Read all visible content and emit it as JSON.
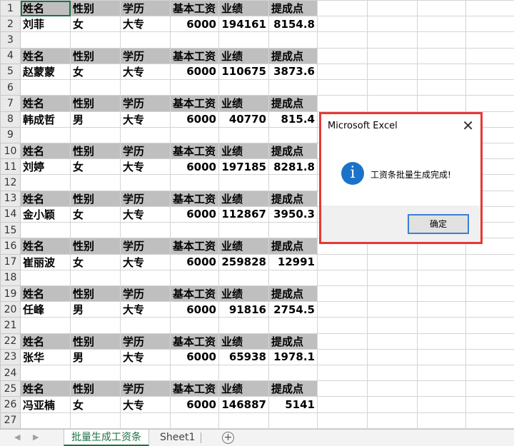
{
  "records": [
    {
      "row_header": "1",
      "data_row": "2",
      "name": "刘菲",
      "gender": "女",
      "education": "大专",
      "base_salary": "6000",
      "performance": "194161",
      "commission": "8154.8"
    },
    {
      "row_header": "4",
      "data_row": "5",
      "name": "赵蒙蒙",
      "gender": "女",
      "education": "大专",
      "base_salary": "6000",
      "performance": "110675",
      "commission": "3873.6"
    },
    {
      "row_header": "7",
      "data_row": "8",
      "name": "韩成哲",
      "gender": "男",
      "education": "大专",
      "base_salary": "6000",
      "performance": "40770",
      "commission": "815.4"
    },
    {
      "row_header": "10",
      "data_row": "11",
      "name": "刘婷",
      "gender": "女",
      "education": "大专",
      "base_salary": "6000",
      "performance": "197185",
      "commission": "8281.8"
    },
    {
      "row_header": "13",
      "data_row": "14",
      "name": "金小颖",
      "gender": "女",
      "education": "大专",
      "base_salary": "6000",
      "performance": "112867",
      "commission": "3950.3"
    },
    {
      "row_header": "16",
      "data_row": "17",
      "name": "崔丽波",
      "gender": "女",
      "education": "大专",
      "base_salary": "6000",
      "performance": "259828",
      "commission": "12991"
    },
    {
      "row_header": "19",
      "data_row": "20",
      "name": "任峰",
      "gender": "男",
      "education": "大专",
      "base_salary": "6000",
      "performance": "91816",
      "commission": "2754.5"
    },
    {
      "row_header": "22",
      "data_row": "23",
      "name": "张华",
      "gender": "男",
      "education": "大专",
      "base_salary": "6000",
      "performance": "65938",
      "commission": "1978.1"
    },
    {
      "row_header": "25",
      "data_row": "26",
      "name": "冯亚楠",
      "gender": "女",
      "education": "大专",
      "base_salary": "6000",
      "performance": "146887",
      "commission": "5141"
    }
  ],
  "blank_rows": [
    "3",
    "6",
    "9",
    "12",
    "15",
    "18",
    "21",
    "24",
    "27"
  ],
  "column_headers": {
    "name": "姓名",
    "gender": "性别",
    "education": "学历",
    "base_salary": "基本工资",
    "performance": "业绩",
    "commission": "提成点"
  },
  "sheet_tabs": {
    "active": "批量生成工资条",
    "other": "Sheet1",
    "add_symbol": "+"
  },
  "dialog": {
    "title": "Microsoft Excel",
    "message": "工资条批量生成完成!",
    "ok_label": "确定",
    "close_symbol": "✕",
    "icon_symbol": "i"
  },
  "colors": {
    "header_fill": "#bfbfbf",
    "accent": "#1e7145",
    "dialog_highlight": "#e53935",
    "info_icon": "#1a73c9"
  }
}
